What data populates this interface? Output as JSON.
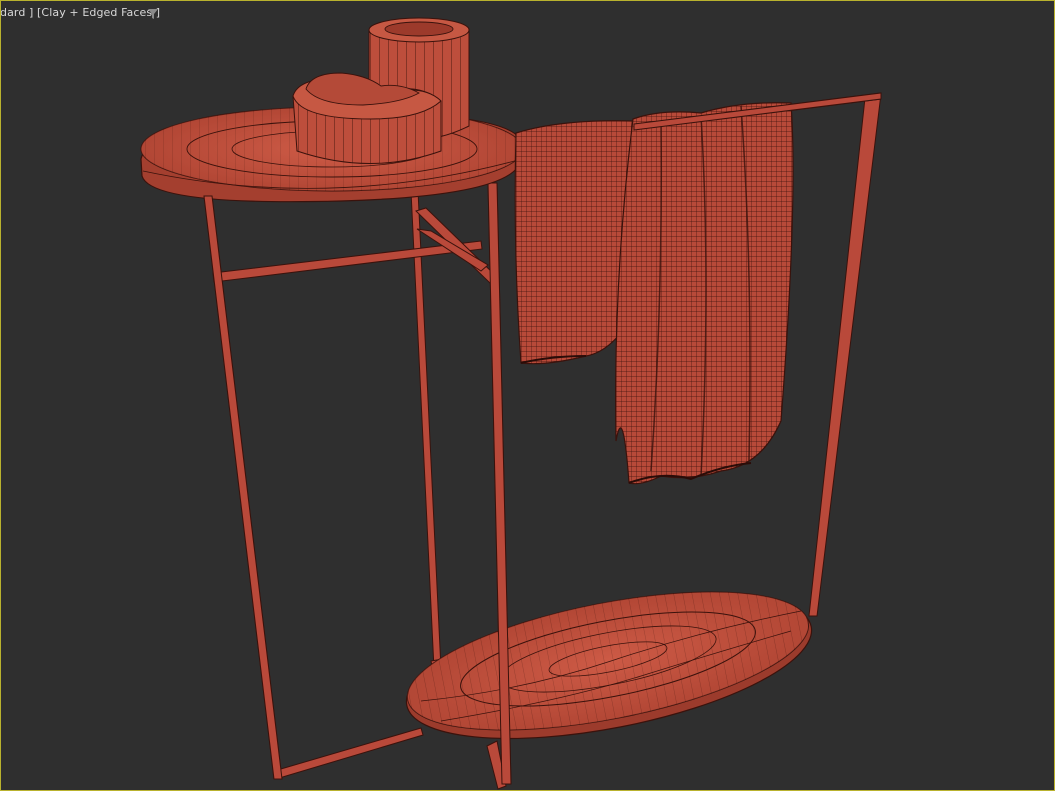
{
  "viewport": {
    "label_prefix": "dard ] ",
    "shading_label": "[Clay + Edged Faces ]",
    "filter_icon": "filter-funnel-icon",
    "border_color": "#b9b22e",
    "background_color": "#2f2f2f"
  },
  "scene": {
    "object": "side table with towel rack",
    "material_color": "#c0513f",
    "edge_color": "#3a120c"
  }
}
